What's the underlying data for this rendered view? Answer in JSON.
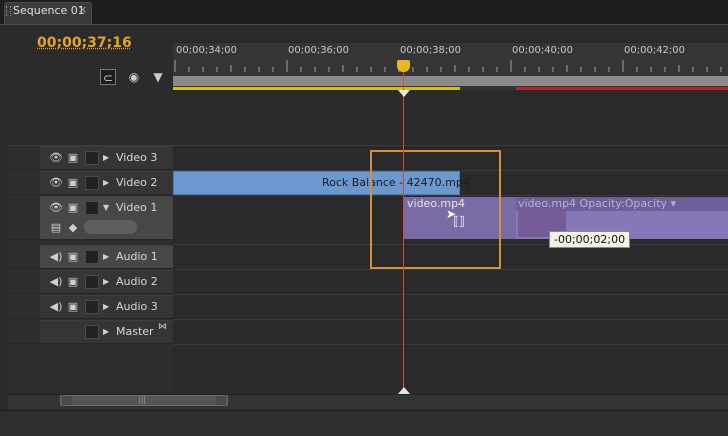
{
  "tab": {
    "label": "Sequence 01",
    "close": "×"
  },
  "timecode": "00;00;37;16",
  "ruler": {
    "ticks": [
      "00;00;34;00",
      "00;00;36;00",
      "00;00;38;00",
      "00;00;40;00",
      "00;00;42;00"
    ]
  },
  "tracks": [
    {
      "name": "Video 3",
      "type": "video"
    },
    {
      "name": "Video 2",
      "type": "video"
    },
    {
      "name": "Video 1",
      "type": "video",
      "expanded": true
    },
    {
      "name": "Audio 1",
      "type": "audio"
    },
    {
      "name": "Audio 2",
      "type": "audio"
    },
    {
      "name": "Audio 3",
      "type": "audio"
    },
    {
      "name": "Master",
      "type": "master"
    }
  ],
  "clips": {
    "rock_balance": "Rock Balance - 42470.mp4",
    "video1": "video.mp4",
    "video2": "video.mp4 Opacity:Opacity ▾"
  },
  "tooltip": "-00;00;02;00",
  "colors": {
    "timecode": "#e8a32a",
    "video_clip": "#7a6aa6",
    "blue_clip": "#6b99cf",
    "playhead": "#d24a30",
    "selection": "#d98e3a"
  },
  "icons": {
    "snap": "snap-icon",
    "marker": "marker-icon",
    "eye": "eye-icon",
    "speaker": "speaker-icon",
    "film": "film-icon"
  }
}
